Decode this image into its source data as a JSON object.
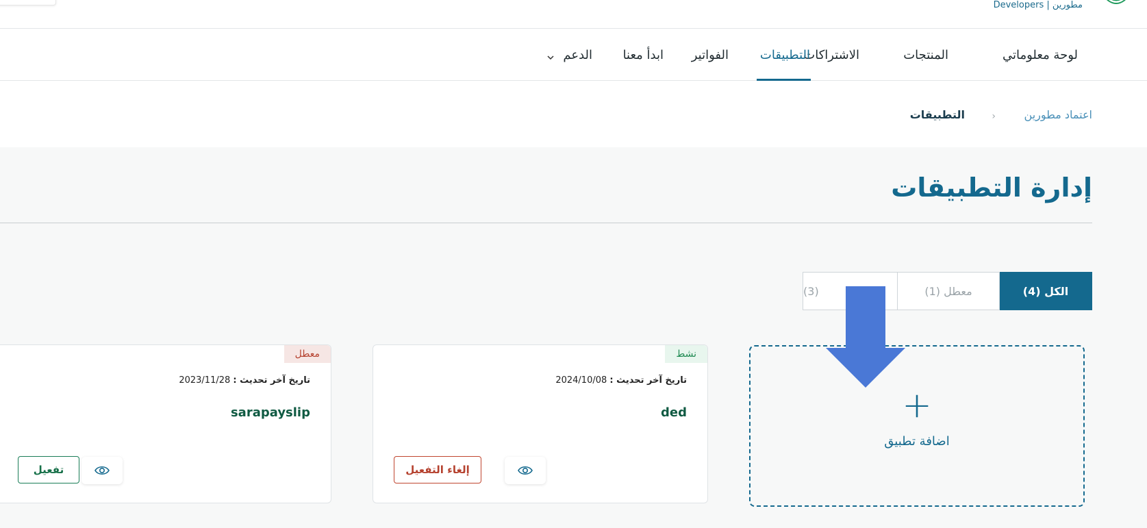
{
  "header": {
    "brand": "مطورين | Developers"
  },
  "nav": {
    "items": [
      {
        "label": "لوحة معلوماتي"
      },
      {
        "label": "المنتجات"
      },
      {
        "label": "الاشتراكات"
      },
      {
        "label": "التطبيقات",
        "active": true
      },
      {
        "label": "الفواتير"
      },
      {
        "label": "ابدأ معنا"
      },
      {
        "label": "الدعم",
        "has_dropdown": true
      }
    ]
  },
  "breadcrumb": {
    "parent": "اعتماد مطورين",
    "separator": "‹",
    "current": "التطبيقات"
  },
  "page": {
    "title": "إدارة التطبيقات"
  },
  "tabs": [
    {
      "label": "الكل (4)",
      "active": true
    },
    {
      "label": "معطل (1)"
    },
    {
      "label": "(3)"
    }
  ],
  "add_app": {
    "plus": "+",
    "label": "اضافة تطبيق"
  },
  "apps": [
    {
      "status": "نشط",
      "updated_label": "تاريخ آخر تحديث :",
      "updated_value": "2024/10/08",
      "name": "ded",
      "action": "إلغاء التفعيل"
    },
    {
      "status": "معطل",
      "updated_label": "تاريخ آخر تحديث :",
      "updated_value": "2023/11/28",
      "name": "sarapayslip",
      "action": "تفعيل"
    }
  ],
  "colors": {
    "primary": "#14698e",
    "active_status": "#1f8a52",
    "disabled_status": "#b5412e",
    "annotation_arrow": "#4a78d6"
  },
  "icons": {
    "logo": "brand-logo-icon",
    "view": "eye-icon",
    "dropdown": "chevron-down-icon",
    "annotation": "arrow-down-icon"
  }
}
